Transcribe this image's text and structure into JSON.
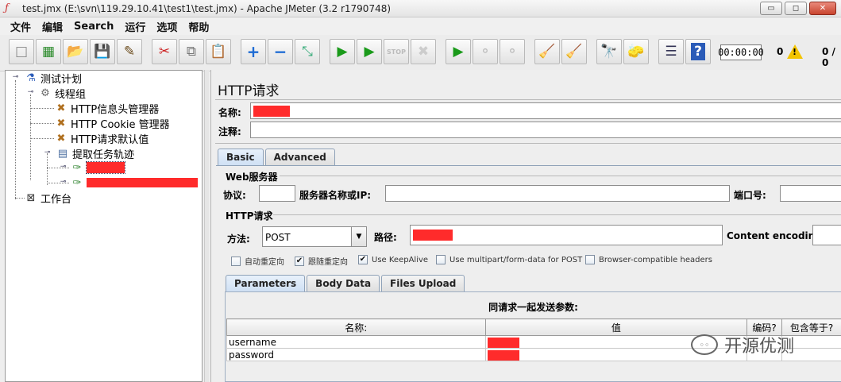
{
  "window": {
    "title": "test.jmx (E:\\svn\\119.29.10.41\\test1\\test.jmx) - Apache JMeter (3.2 r1790748)",
    "controls": [
      "▭",
      "◻",
      "✕"
    ]
  },
  "menu": [
    "文件",
    "编辑",
    "Search",
    "运行",
    "选项",
    "帮助"
  ],
  "toolbar": {
    "buttons": [
      {
        "name": "new-icon",
        "glyph": "□"
      },
      {
        "name": "templates-icon",
        "glyph": "▦"
      },
      {
        "name": "open-icon",
        "glyph": "📂"
      },
      {
        "name": "save-icon",
        "glyph": "💾"
      },
      {
        "name": "save-as-icon",
        "glyph": "✎"
      },
      {
        "name": "cut-icon",
        "glyph": "✂"
      },
      {
        "name": "copy-icon",
        "glyph": "⧉"
      },
      {
        "name": "paste-icon",
        "glyph": "📋"
      },
      {
        "name": "expand-icon",
        "glyph": "+"
      },
      {
        "name": "collapse-icon",
        "glyph": "−"
      },
      {
        "name": "toggle-icon",
        "glyph": "⤡"
      },
      {
        "name": "start-icon",
        "glyph": "▶"
      },
      {
        "name": "start-no-pause-icon",
        "glyph": "▶"
      },
      {
        "name": "stop-icon",
        "glyph": "STOP"
      },
      {
        "name": "shutdown-icon",
        "glyph": "✖"
      },
      {
        "name": "remote-start-icon",
        "glyph": "▶"
      },
      {
        "name": "remote-stop-icon",
        "glyph": "⚬"
      },
      {
        "name": "remote-shutdown-icon",
        "glyph": "⚬"
      },
      {
        "name": "clear-icon",
        "glyph": "🧹"
      },
      {
        "name": "clear-all-icon",
        "glyph": "🧹"
      },
      {
        "name": "search-icon",
        "glyph": "🔭"
      },
      {
        "name": "reset-search-icon",
        "glyph": "🧽"
      },
      {
        "name": "function-helper-icon",
        "glyph": "☰"
      },
      {
        "name": "help-icon",
        "glyph": "?"
      }
    ],
    "timer": "00:00:00",
    "error_count": "0",
    "threads": "0 / 0"
  },
  "tree": {
    "test_plan": "测试计划",
    "thread_group": "线程组",
    "header_manager": "HTTP信息头管理器",
    "cookie_manager": "HTTP Cookie 管理器",
    "request_defaults": "HTTP请求默认值",
    "transaction": "提取任务轨迹",
    "workbench": "工作台"
  },
  "editor": {
    "title": "HTTP请求",
    "name_label": "名称:",
    "comment_label": "注释:",
    "tabs": [
      "Basic",
      "Advanced"
    ],
    "web_server_group": "Web服务器",
    "protocol_label": "协议:",
    "server_label": "服务器名称或IP:",
    "port_label": "端口号:",
    "http_request_group": "HTTP请求",
    "method_label": "方法:",
    "method_value": "POST",
    "path_label": "路径:",
    "encoding_label": "Content encoding:",
    "checkboxes": [
      {
        "label": "自动重定向",
        "checked": false
      },
      {
        "label": "跟随重定向",
        "checked": true
      },
      {
        "label": "Use KeepAlive",
        "checked": true
      },
      {
        "label": "Use multipart/form-data for POST",
        "checked": false
      },
      {
        "label": "Browser-compatible headers",
        "checked": false
      }
    ],
    "param_tabs": [
      "Parameters",
      "Body Data",
      "Files Upload"
    ],
    "params_caption": "同请求一起发送参数:",
    "columns": [
      "名称:",
      "值",
      "编码?",
      "包含等于?"
    ],
    "rows": [
      {
        "name": "username"
      },
      {
        "name": "password"
      }
    ]
  },
  "watermark": "开源优测",
  "colors": {
    "redaction": "#ff2b2b",
    "tab_active": "#cfe0f4"
  }
}
